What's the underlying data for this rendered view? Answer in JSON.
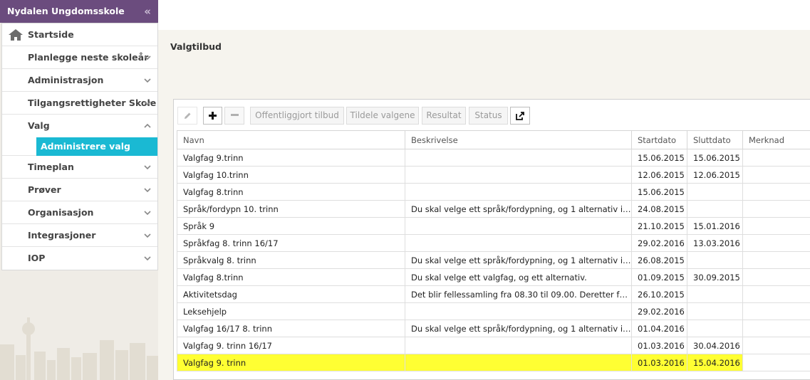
{
  "sidebar": {
    "title": "Nydalen Ungdomsskole",
    "collapse_icon": "double-chevron-left-icon",
    "items": [
      {
        "label": "Startside",
        "icon": "home-icon"
      },
      {
        "label": "Planlegge neste skoleår"
      },
      {
        "label": "Administrasjon"
      },
      {
        "label": "Tilgangsrettigheter Skole"
      },
      {
        "label": "Valg",
        "expanded": true
      },
      {
        "label": "Timeplan"
      },
      {
        "label": "Prøver"
      },
      {
        "label": "Organisasjon"
      },
      {
        "label": "Integrasjoner"
      },
      {
        "label": "IOP"
      }
    ],
    "active_subitem": "Administrere valg"
  },
  "main": {
    "title": "Valgtilbud",
    "toolbar": {
      "edit_icon": "pencil-icon",
      "add_icon": "plus-icon",
      "remove_icon": "minus-icon",
      "publish": "Offentliggjort tilbud",
      "assign": "Tildele valgene",
      "result": "Resultat",
      "status": "Status",
      "export_icon": "export-icon"
    },
    "table": {
      "columns": [
        "Navn",
        "Beskrivelse",
        "Startdato",
        "Sluttdato",
        "Merknad"
      ],
      "rows": [
        [
          "Valgfag 9.trinn",
          "",
          "15.06.2015",
          "15.06.2015",
          ""
        ],
        [
          "Valgfag 10.trinn",
          "",
          "12.06.2015",
          "12.06.2015",
          ""
        ],
        [
          "Valgfag 8.trinn",
          "",
          "15.06.2015",
          "",
          ""
        ],
        [
          "Språk/fordypn 10. trinn",
          "Du skal velge ett språk/fordypning, og 1 alternativ i t...",
          "24.08.2015",
          "",
          ""
        ],
        [
          "Språk 9",
          "",
          "21.10.2015",
          "15.01.2016",
          ""
        ],
        [
          "Språkfag 8. trinn 16/17",
          "",
          "29.02.2016",
          "13.03.2016",
          ""
        ],
        [
          "Språkvalg 8. trinn",
          "Du skal velge ett språk/fordypning, og 1 alternativ i t...",
          "26.08.2015",
          "",
          ""
        ],
        [
          "Valgfag 8.trinn",
          "Du skal velge ett valgfag, og ett alternativ.",
          "01.09.2015",
          "30.09.2015",
          ""
        ],
        [
          "Aktivitetsdag",
          "Det blir fellessamling fra 08.30 til 09.00. Deretter for...",
          "26.10.2015",
          "",
          ""
        ],
        [
          "Leksehjelp",
          "",
          "29.02.2016",
          "",
          ""
        ],
        [
          "Valgfag 16/17 8. trinn",
          "Du skal velge ett språk/fordypning, og 1 alternativ i t...",
          "01.04.2016",
          "",
          ""
        ],
        [
          "Valgfag 9. trinn 16/17",
          "",
          "01.03.2016",
          "30.04.2016",
          ""
        ],
        [
          "Valgfag 9. trinn",
          "",
          "01.03.2016",
          "15.04.2016",
          ""
        ]
      ],
      "selected_row": 12
    }
  },
  "colors": {
    "sidebar_header": "#6b4c7e",
    "active_subitem": "#1ab9d3",
    "selected_row": "#ffff33"
  }
}
